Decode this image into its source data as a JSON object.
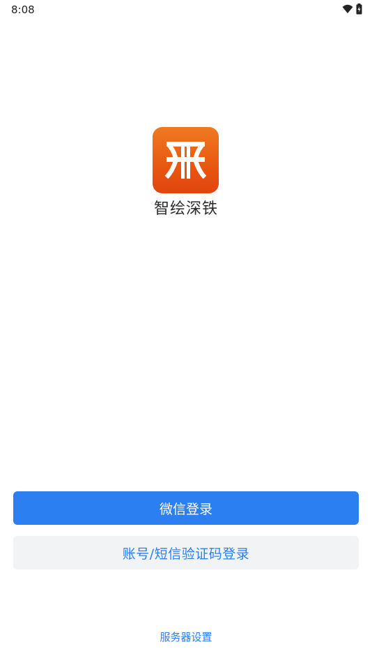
{
  "status_bar": {
    "time": "8:08",
    "icons": [
      "wifi-icon",
      "battery-charging-icon"
    ]
  },
  "app": {
    "logo_icon": "shenzhen-metro-logo-icon",
    "name": "智绘深铁",
    "brand_colors": {
      "logo_top": "#ef7a22",
      "logo_bottom": "#e2440d"
    }
  },
  "login": {
    "wechat_label": "微信登录",
    "account_label": "账号/短信验证码登录",
    "server_settings_label": "服务器设置"
  },
  "colors": {
    "primary": "#2b7ff0",
    "secondary_bg": "#f2f3f4"
  }
}
